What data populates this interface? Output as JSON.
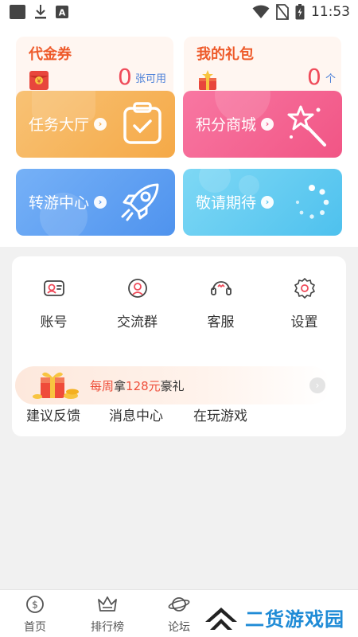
{
  "status_bar": {
    "time": "11:53"
  },
  "cards": {
    "coupon": {
      "title": "代金券",
      "count": "0",
      "unit": "张可用"
    },
    "gift": {
      "title": "我的礼包",
      "count": "0",
      "unit": "个"
    }
  },
  "tiles": [
    {
      "label": "任务大厅",
      "arrow": "›",
      "color": "#f6b45c",
      "icon": "clipboard-check-icon"
    },
    {
      "label": "积分商城",
      "arrow": "›",
      "color": "#f4608e",
      "icon": "magic-wand-icon"
    },
    {
      "label": "转游中心",
      "arrow": "›",
      "color": "#5da2f3",
      "icon": "rocket-icon"
    },
    {
      "label": "敬请期待",
      "arrow": "›",
      "color": "#5fcaf0",
      "icon": "loading-spinner-icon"
    }
  ],
  "menu": {
    "items": [
      {
        "label": "账号",
        "icon": "account-icon"
      },
      {
        "label": "交流群",
        "icon": "chat-group-icon"
      },
      {
        "label": "客服",
        "icon": "customer-service-icon"
      },
      {
        "label": "设置",
        "icon": "gear-icon"
      }
    ],
    "banner": {
      "prefix": "每周",
      "verb": "拿",
      "amount": "128元",
      "suffix": "豪礼"
    },
    "lower": [
      {
        "label": "建议反馈"
      },
      {
        "label": "消息中心"
      },
      {
        "label": "在玩游戏"
      }
    ]
  },
  "bottom_nav": {
    "items": [
      {
        "label": "首页",
        "icon": "home-coin-icon"
      },
      {
        "label": "排行榜",
        "icon": "crown-icon"
      },
      {
        "label": "论坛",
        "icon": "planet-icon"
      }
    ]
  },
  "watermark": {
    "text": "二货游戏园"
  }
}
